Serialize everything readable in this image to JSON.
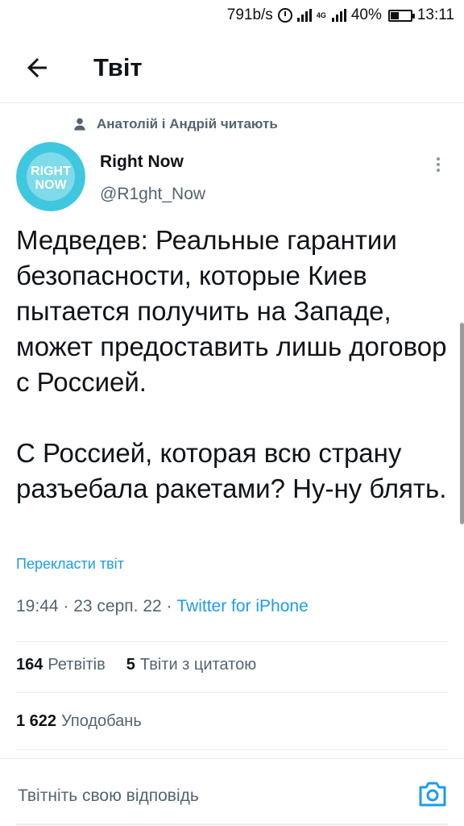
{
  "status_bar": {
    "speed": "791b/s",
    "network": "4G",
    "battery": "40%",
    "time": "13:11"
  },
  "header": {
    "title": "Твіт"
  },
  "social_context": "Анатолій і Андрій читають",
  "author": {
    "avatar_text_line1": "RIGHT",
    "avatar_text_line2": "NOW",
    "display_name": "Right Now",
    "handle": "@R1ght_Now"
  },
  "tweet": {
    "text": "Медведев: Реальные гарантии безопасности, которые Киев пытается получить на Западе, может предоставить лишь договор с Россией.\n\nС Россией, которая всю страну разъебала ракетами? Ну-ну блять.",
    "translate_label": "Перекласти твіт",
    "time": "19:44",
    "date": "23 серп. 22",
    "source": "Twitter for iPhone"
  },
  "stats": {
    "retweets_count": "164",
    "retweets_label": "Ретвітів",
    "quotes_count": "5",
    "quotes_label": "Твіти з цитатою",
    "likes_count": "1 622",
    "likes_label": "Уподобань"
  },
  "reply": {
    "placeholder": "Твітніть свою відповідь"
  },
  "colors": {
    "accent": "#1d9bf0",
    "secondary_text": "#536471",
    "avatar_bg": "#40c7e0"
  }
}
